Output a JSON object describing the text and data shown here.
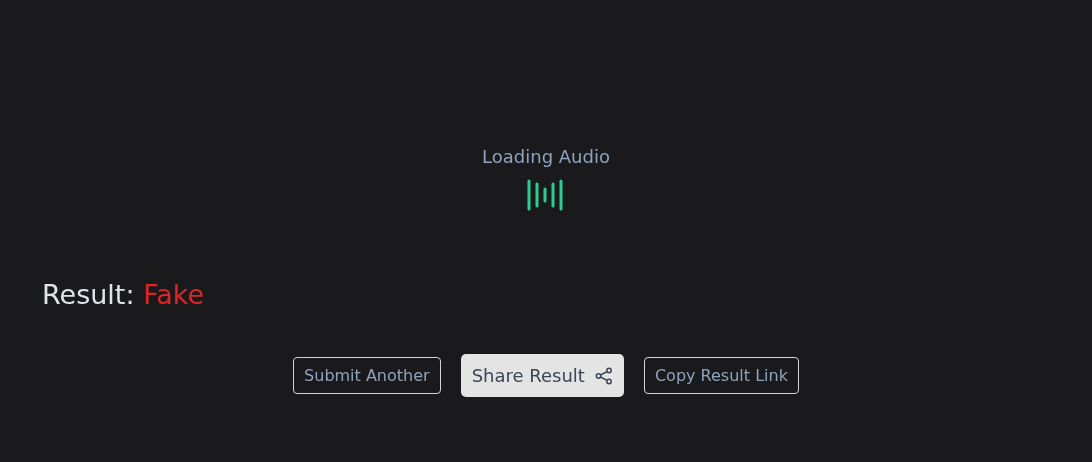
{
  "loader": {
    "label": "Loading Audio"
  },
  "result": {
    "label": "Result:",
    "value": "Fake"
  },
  "buttons": [
    {
      "label": "Submit Another",
      "kind": "outline"
    },
    {
      "label": "Share Result",
      "kind": "share"
    },
    {
      "label": "Copy Result Link",
      "kind": "outline"
    }
  ]
}
